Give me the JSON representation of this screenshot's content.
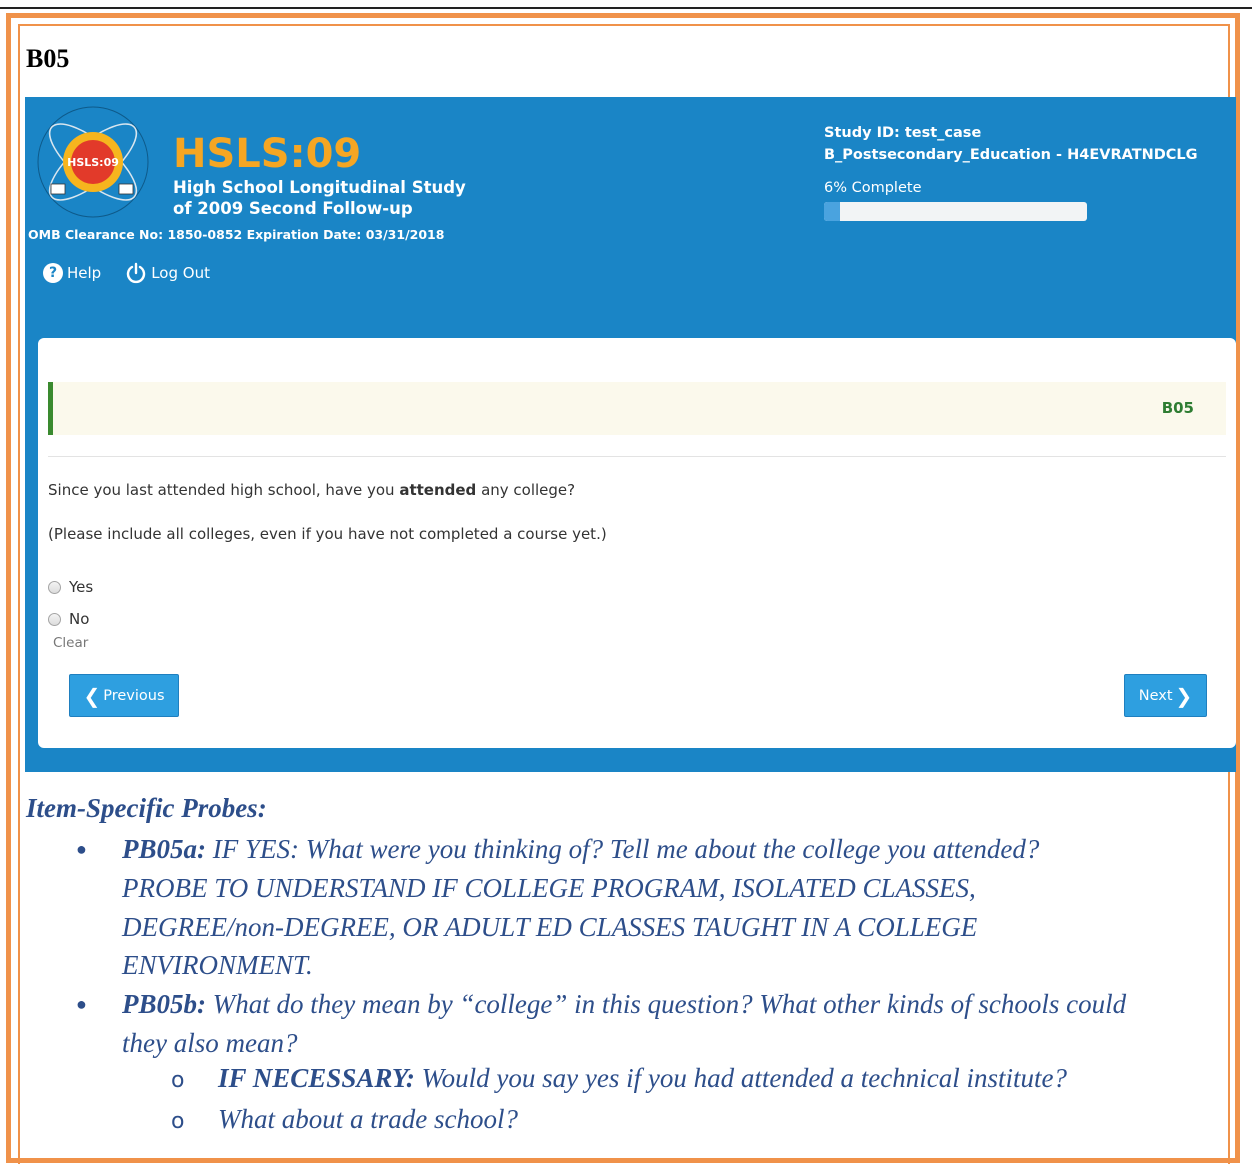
{
  "page_heading": "B05",
  "header": {
    "logo_text": "HSLS:09",
    "brand": "HSLS:09",
    "brand_sub_line1": "High School Longitudinal Study",
    "brand_sub_line2": "of 2009 Second Follow-up",
    "omb": "OMB Clearance No: 1850-0852 Expiration Date: 03/31/2018",
    "help_label": "Help",
    "logout_label": "Log Out",
    "study_id": "Study ID: test_case",
    "section": "B_Postsecondary_Education - H4EVRATNDCLG",
    "progress_label": "6% Complete",
    "progress_value": 0.06,
    "colors": {
      "header_bg": "#1a85c6",
      "brand": "#f5a623",
      "progress_fill": "#4aa3df"
    }
  },
  "question": {
    "code": "B05",
    "text_before": "Since you last attended high school, have you ",
    "text_bold": "attended",
    "text_after": " any college?",
    "note": "(Please include all colleges, even if you have not completed a course yet.)",
    "options": [
      "Yes",
      "No"
    ],
    "clear_label": "Clear",
    "prev_label": "Previous",
    "next_label": "Next"
  },
  "probes": {
    "title": "Item-Specific Probes:",
    "pb05a_label": "PB05a:",
    "pb05a_lines": [
      " IF YES:  What were you thinking of?  Tell me about the college you attended?",
      "PROBE TO UNDERSTAND IF COLLEGE PROGRAM, ISOLATED CLASSES,",
      "DEGREE/non-DEGREE, OR ADULT ED CLASSES TAUGHT IN A COLLEGE",
      "ENVIRONMENT."
    ],
    "pb05b_label": "PB05b:",
    "pb05b_lines": [
      " What do they mean by “college” in this question?  What other kinds of schools could",
      "they also mean?"
    ],
    "sub1_label": "IF NECESSARY:",
    "sub1_text": "  Would you say yes if you had attended a technical institute?",
    "sub2_text": "What about a trade school?",
    "sub_marker": "o"
  }
}
